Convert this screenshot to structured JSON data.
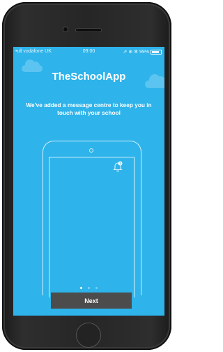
{
  "status_bar": {
    "carrier": "•ull vodafone UK",
    "wifi_icon": "wifi-icon",
    "time": "09:00",
    "indicators": "⇗ ⊕ ✻ 99%",
    "battery_icon": "battery-icon"
  },
  "onboarding": {
    "app_title": "TheSchoolApp",
    "message": "We've added a message centre to keep you in touch with your school",
    "illustration_icon": "phone-illustration-icon",
    "bell_icon": "bell-icon",
    "notification_count": "1",
    "page_indicator": {
      "pages": 3,
      "active": 1
    },
    "next_label": "Next"
  },
  "colors": {
    "background": "#2eb3ea",
    "button": "#4c4c4c",
    "text": "#ffffff"
  }
}
